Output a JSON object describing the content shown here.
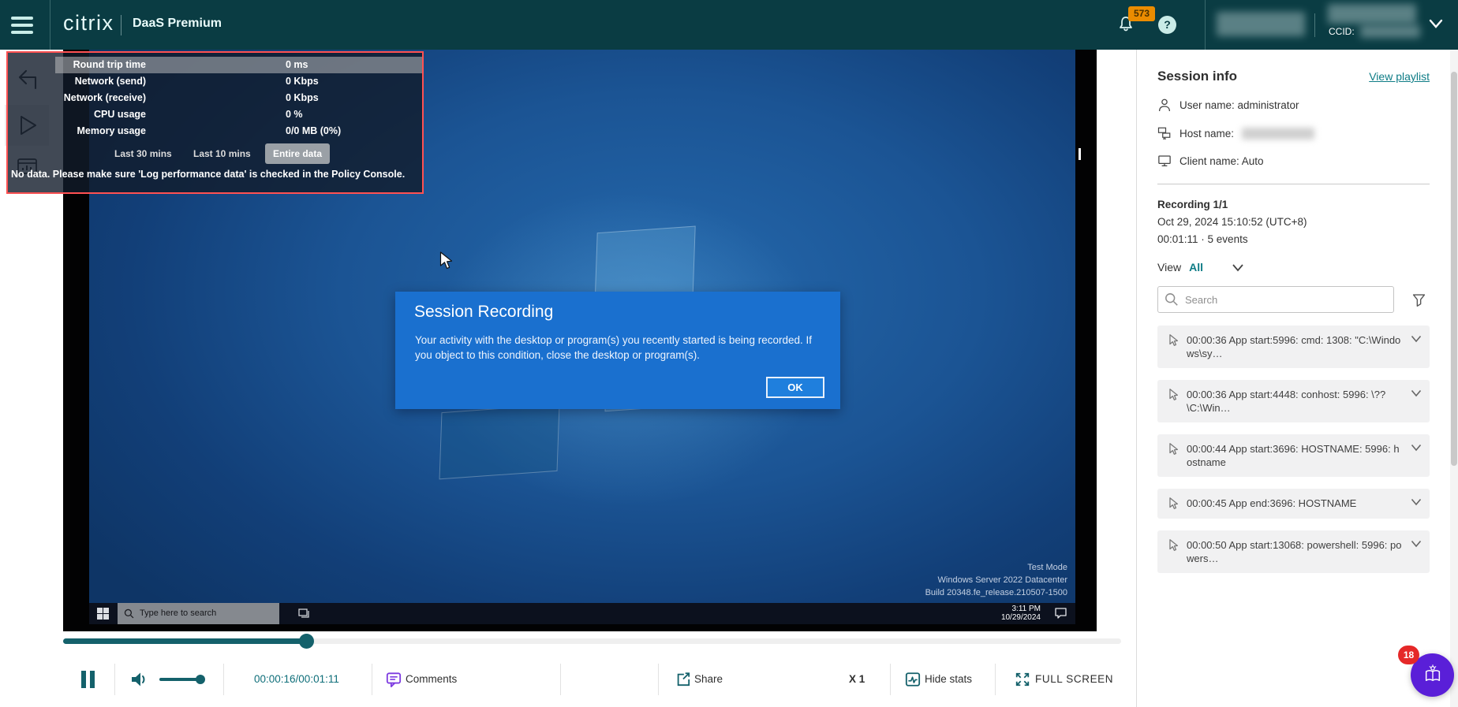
{
  "header": {
    "brand": "citrix",
    "product": "DaaS Premium",
    "notification_count": "573",
    "help_glyph": "?",
    "ccid_label": "CCID:"
  },
  "stats_overlay": {
    "rows": [
      {
        "label": "Round trip time",
        "value": "0 ms"
      },
      {
        "label": "Network (send)",
        "value": "0 Kbps"
      },
      {
        "label": "Network (receive)",
        "value": "0 Kbps"
      },
      {
        "label": "CPU usage",
        "value": "0 %"
      },
      {
        "label": "Memory usage",
        "value": "0/0 MB (0%)"
      }
    ],
    "ranges": [
      {
        "label": "Last 30 mins",
        "active": false
      },
      {
        "label": "Last 10 mins",
        "active": false
      },
      {
        "label": "Entire data",
        "active": true
      }
    ],
    "no_data_message": "No data. Please make sure 'Log performance data' is checked in the Policy Console."
  },
  "video": {
    "dialog": {
      "title": "Session Recording",
      "body": "Your activity with the desktop or program(s) you recently started is being recorded. If you object to this condition, close the desktop or program(s).",
      "ok_label": "OK"
    },
    "watermark": [
      "Test Mode",
      "Windows Server 2022 Datacenter",
      "Build 20348.fe_release.210507-1500"
    ],
    "taskbar": {
      "search_placeholder": "Type here to search",
      "time": "3:11 PM",
      "date": "10/29/2024"
    }
  },
  "player": {
    "time_display": "00:00:16/00:01:11",
    "comments_label": "Comments",
    "share_label": "Share",
    "speed_label": "X 1",
    "hide_stats_label": "Hide stats",
    "fullscreen_label": "FULL SCREEN",
    "progress_percent": 23
  },
  "session_panel": {
    "title": "Session info",
    "view_playlist_label": "View playlist",
    "user_name": "User name: administrator",
    "host_name_label": "Host name:",
    "client_name": "Client name: Auto",
    "recording_title": "Recording 1/1",
    "recording_timestamp": "Oct 29, 2024 15:10:52 (UTC+8)",
    "recording_meta": "00:01:11 · 5 events",
    "view_label": "View",
    "view_value": "All",
    "search_placeholder": "Search",
    "events": [
      {
        "text": "00:00:36 App start:5996: cmd: 1308: \"C:\\Windows\\sy…"
      },
      {
        "text": "00:00:36 App start:4448: conhost: 5996: \\??\\C:\\Win…"
      },
      {
        "text": "00:00:44 App start:3696: HOSTNAME: 5996: hostname"
      },
      {
        "text": "00:00:45 App end:3696: HOSTNAME"
      },
      {
        "text": "00:00:50 App start:13068: powershell: 5996: powers…"
      }
    ]
  },
  "fab": {
    "badge_count": "18"
  },
  "colors": {
    "header_bg": "#0a3c43",
    "accent_teal": "#0e7c86",
    "player_teal": "#14616b",
    "badge_orange": "#eb8c00",
    "dialog_blue": "#1a70cf",
    "fab_purple": "#5a1fd8",
    "badge_red": "#e52828",
    "stats_border_red": "#ff5152",
    "comments_purple": "#7d3be0"
  }
}
